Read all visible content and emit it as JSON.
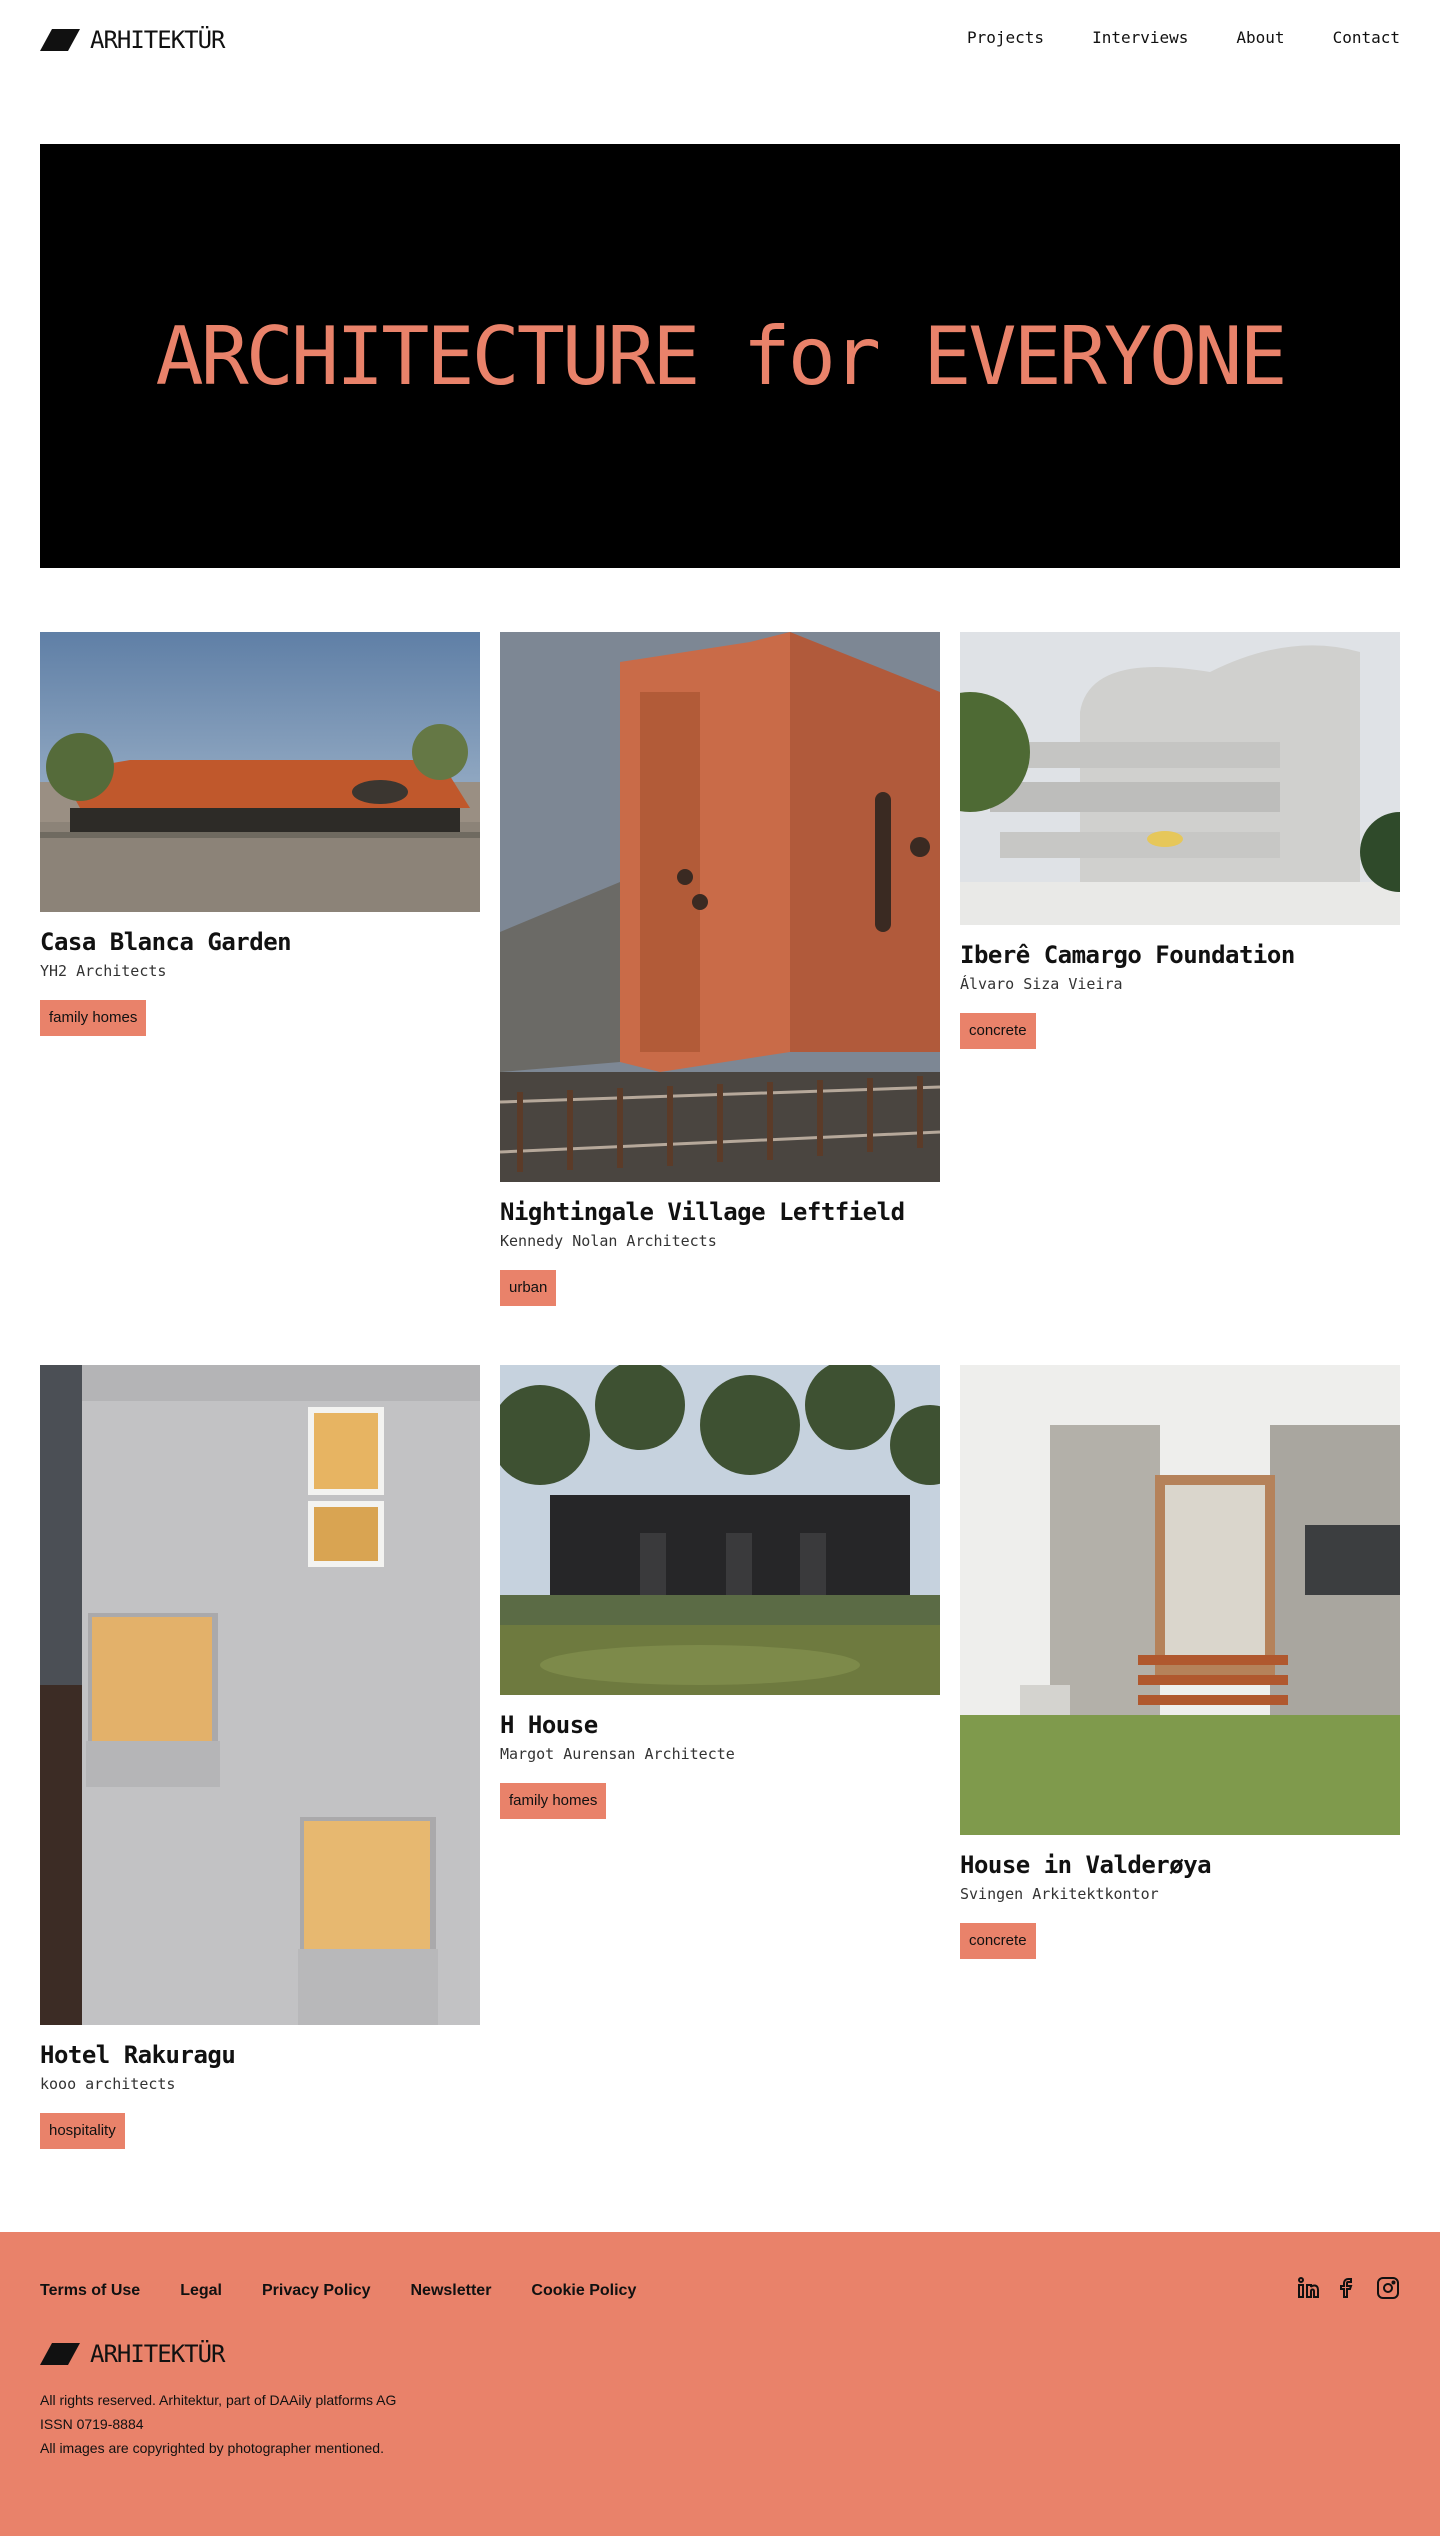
{
  "brand": {
    "name": "ARHITEKTÜR"
  },
  "nav": {
    "items": [
      "Projects",
      "Interviews",
      "About",
      "Contact"
    ]
  },
  "hero": {
    "headline": "ARCHITECTURE for EVERYONE"
  },
  "projects": [
    {
      "title": "Casa Blanca Garden",
      "architect": "YH2 Architects",
      "tag": "family homes",
      "image": "tiled-roof-pavilion"
    },
    {
      "title": "Nightingale Village Leftfield",
      "architect": "Kennedy Nolan Architects",
      "tag": "urban",
      "image": "terracotta-apartment-building"
    },
    {
      "title": "Iberê Camargo Foundation",
      "architect": "Álvaro Siza Vieira",
      "tag": "concrete",
      "image": "white-concrete-museum"
    },
    {
      "title": "Hotel Rakuragu",
      "architect": "kooo architects",
      "tag": "hospitality",
      "image": "grey-hotel-facade"
    },
    {
      "title": "H House",
      "architect": "Margot Aurensan Architecte",
      "tag": "family homes",
      "image": "black-timber-house"
    },
    {
      "title": "House in Valderøya",
      "architect": "Svingen Arkitektkontor",
      "tag": "concrete",
      "image": "concrete-cabin"
    }
  ],
  "footer": {
    "links": [
      "Terms of Use",
      "Legal",
      "Privacy Policy",
      "Newsletter",
      "Cookie Policy"
    ],
    "socials": [
      "linkedin-icon",
      "facebook-icon",
      "instagram-icon"
    ],
    "copyright": "All rights reserved. Arhitektur, part of DAAily platforms AG",
    "issn": "ISSN 0719-8884",
    "image_credit": "All images are copyrighted by photographer mentioned."
  },
  "colors": {
    "accent": "#e9826a",
    "hero_bg": "#000000",
    "text": "#111111"
  }
}
